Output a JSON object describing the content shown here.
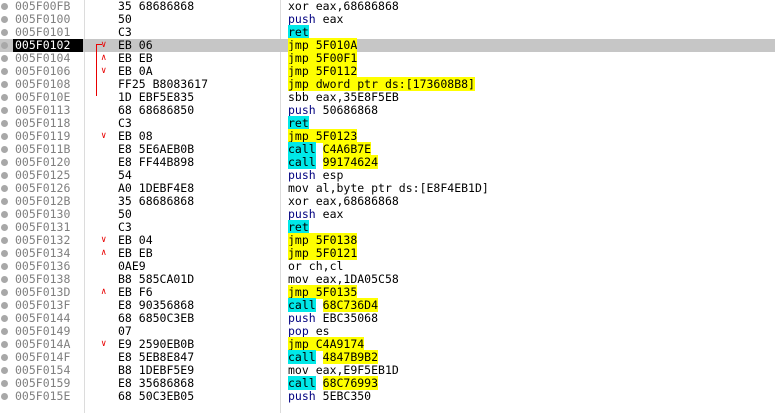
{
  "rows": [
    {
      "addr": "005F00FB",
      "bp": true,
      "arrow": "",
      "bytes": "35 68686868",
      "mnem": "xor",
      "ops": "eax,68686868",
      "kind": "plain"
    },
    {
      "addr": "005F0100",
      "bp": true,
      "arrow": "",
      "bytes": "50",
      "mnem": "push",
      "ops": "eax",
      "kind": "push"
    },
    {
      "addr": "005F0101",
      "bp": true,
      "arrow": "",
      "bytes": "C3",
      "mnem": "ret",
      "ops": "",
      "kind": "ret"
    },
    {
      "addr": "005F0102",
      "bp": true,
      "arrow": "v",
      "bytes": "EB 06",
      "mnem": "jmp",
      "ops": "5F010A",
      "kind": "jmp",
      "selected": true
    },
    {
      "addr": "005F0104",
      "bp": true,
      "arrow": "^",
      "bytes": "EB EB",
      "mnem": "jmp",
      "ops": "5F00F1",
      "kind": "jmp"
    },
    {
      "addr": "005F0106",
      "bp": true,
      "arrow": "v",
      "bytes": "EB 0A",
      "mnem": "jmp",
      "ops": "5F0112",
      "kind": "jmp"
    },
    {
      "addr": "005F0108",
      "bp": true,
      "arrow": "",
      "bytes": "FF25 B8083617",
      "mnem": "jmp",
      "ops": "dword ptr ds:[173608B8]",
      "kind": "jmp-mem"
    },
    {
      "addr": "005F010E",
      "bp": true,
      "arrow": "",
      "bytes": "1D EBF5E835",
      "mnem": "sbb",
      "ops": "eax,35E8F5EB",
      "kind": "plain"
    },
    {
      "addr": "005F0113",
      "bp": true,
      "arrow": "",
      "bytes": "68 68686850",
      "mnem": "push",
      "ops": "50686868",
      "kind": "push"
    },
    {
      "addr": "005F0118",
      "bp": true,
      "arrow": "",
      "bytes": "C3",
      "mnem": "ret",
      "ops": "",
      "kind": "ret"
    },
    {
      "addr": "005F0119",
      "bp": true,
      "arrow": "v",
      "bytes": "EB 08",
      "mnem": "jmp",
      "ops": "5F0123",
      "kind": "jmp"
    },
    {
      "addr": "005F011B",
      "bp": true,
      "arrow": "",
      "bytes": "E8 5E6AEB0B",
      "mnem": "call",
      "ops": "C4A6B7E",
      "kind": "call"
    },
    {
      "addr": "005F0120",
      "bp": true,
      "arrow": "",
      "bytes": "E8 FF44B898",
      "mnem": "call",
      "ops": "99174624",
      "kind": "call"
    },
    {
      "addr": "005F0125",
      "bp": true,
      "arrow": "",
      "bytes": "54",
      "mnem": "push",
      "ops": "esp",
      "kind": "push"
    },
    {
      "addr": "005F0126",
      "bp": true,
      "arrow": "",
      "bytes": "A0 1DEBF4E8",
      "mnem": "mov",
      "ops": "al,byte ptr ds:[E8F4EB1D]",
      "kind": "mov-mem"
    },
    {
      "addr": "005F012B",
      "bp": true,
      "arrow": "",
      "bytes": "35 68686868",
      "mnem": "xor",
      "ops": "eax,68686868",
      "kind": "plain"
    },
    {
      "addr": "005F0130",
      "bp": true,
      "arrow": "",
      "bytes": "50",
      "mnem": "push",
      "ops": "eax",
      "kind": "push"
    },
    {
      "addr": "005F0131",
      "bp": true,
      "arrow": "",
      "bytes": "C3",
      "mnem": "ret",
      "ops": "",
      "kind": "ret"
    },
    {
      "addr": "005F0132",
      "bp": true,
      "arrow": "v",
      "bytes": "EB 04",
      "mnem": "jmp",
      "ops": "5F0138",
      "kind": "jmp"
    },
    {
      "addr": "005F0134",
      "bp": true,
      "arrow": "^",
      "bytes": "EB EB",
      "mnem": "jmp",
      "ops": "5F0121",
      "kind": "jmp"
    },
    {
      "addr": "005F0136",
      "bp": true,
      "arrow": "",
      "bytes": "0AE9",
      "mnem": "or",
      "ops": "ch,cl",
      "kind": "plain"
    },
    {
      "addr": "005F0138",
      "bp": true,
      "arrow": "",
      "bytes": "B8 585CA01D",
      "mnem": "mov",
      "ops": "eax,1DA05C58",
      "kind": "plain"
    },
    {
      "addr": "005F013D",
      "bp": true,
      "arrow": "^",
      "bytes": "EB F6",
      "mnem": "jmp",
      "ops": "5F0135",
      "kind": "jmp"
    },
    {
      "addr": "005F013F",
      "bp": true,
      "arrow": "",
      "bytes": "E8 90356868",
      "mnem": "call",
      "ops": "68C736D4",
      "kind": "call"
    },
    {
      "addr": "005F0144",
      "bp": true,
      "arrow": "",
      "bytes": "68 6850C3EB",
      "mnem": "push",
      "ops": "EBC35068",
      "kind": "push"
    },
    {
      "addr": "005F0149",
      "bp": true,
      "arrow": "",
      "bytes": "07",
      "mnem": "pop",
      "ops": "es",
      "kind": "push"
    },
    {
      "addr": "005F014A",
      "bp": true,
      "arrow": "v",
      "bytes": "E9 2590EB0B",
      "mnem": "jmp",
      "ops": "C4A9174",
      "kind": "jmp"
    },
    {
      "addr": "005F014F",
      "bp": true,
      "arrow": "",
      "bytes": "E8 5EB8E847",
      "mnem": "call",
      "ops": "4847B9B2",
      "kind": "call"
    },
    {
      "addr": "005F0154",
      "bp": true,
      "arrow": "",
      "bytes": "B8 1DEBF5E9",
      "mnem": "mov",
      "ops": "eax,E9F5EB1D",
      "kind": "plain"
    },
    {
      "addr": "005F0159",
      "bp": true,
      "arrow": "",
      "bytes": "E8 35686868",
      "mnem": "call",
      "ops": "68C76993",
      "kind": "call"
    },
    {
      "addr": "005F015E",
      "bp": true,
      "arrow": "",
      "bytes": "68 50C3EB05",
      "mnem": "push",
      "ops": "5EBC350",
      "kind": "push"
    }
  ],
  "colors": {
    "jmp_highlight": "#ffff00",
    "call_highlight": "#00e8e8",
    "selected_row": "#c6c6c6",
    "selected_addr": "#000000",
    "jump_arrow": "#e80000"
  }
}
